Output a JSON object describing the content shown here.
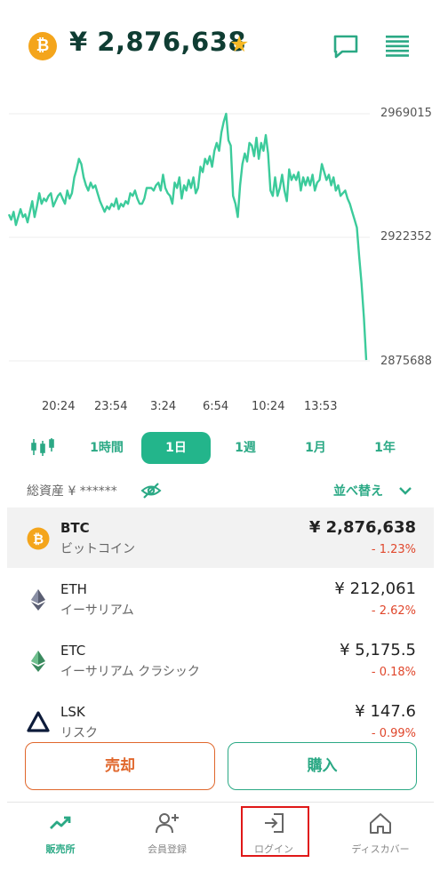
{
  "header": {
    "coin_symbol_glyph": "₿",
    "price": "¥ 2,876,638",
    "star_icon": "star-icon",
    "chat_icon": "chat-icon",
    "menu_icon": "menu-icon"
  },
  "chart_data": {
    "type": "line",
    "y_ticks": [
      "2969015",
      "2922352",
      "2875688"
    ],
    "ylim": [
      2875688,
      2969015
    ],
    "x_ticks": [
      "20:24",
      "23:54",
      "3:24",
      "6:54",
      "10:24",
      "13:53"
    ],
    "series": [
      {
        "values": [
          2931000,
          2929000,
          2932000,
          2927000,
          2930000,
          2933000,
          2930000,
          2931000,
          2928000,
          2932000,
          2936000,
          2930000,
          2934000,
          2939000,
          2935000,
          2937000,
          2936000,
          2938000,
          2939000,
          2934000,
          2936000,
          2938000,
          2939000,
          2937000,
          2935000,
          2940000,
          2937000,
          2939000,
          2945000,
          2948000,
          2952000,
          2950000,
          2945000,
          2942000,
          2940000,
          2943000,
          2941000,
          2942000,
          2939000,
          2936000,
          2934000,
          2932000,
          2934000,
          2933000,
          2935000,
          2934000,
          2937000,
          2933000,
          2935000,
          2934000,
          2936000,
          2935000,
          2939000,
          2938000,
          2940000,
          2937000,
          2935000,
          2935000,
          2937000,
          2941000,
          2941000,
          2941000,
          2940000,
          2942000,
          2943000,
          2940000,
          2946000,
          2941000,
          2939000,
          2938000,
          2935000,
          2943000,
          2941000,
          2945000,
          2937000,
          2942000,
          2940000,
          2944000,
          2941000,
          2945000,
          2939000,
          2941000,
          2949000,
          2947000,
          2952000,
          2950000,
          2953000,
          2949000,
          2955000,
          2958000,
          2955000,
          2962000,
          2966000,
          2969000,
          2959000,
          2957000,
          2938000,
          2935000,
          2930000,
          2942000,
          2950000,
          2954000,
          2951000,
          2958000,
          2957000,
          2953000,
          2960000,
          2952000,
          2958000,
          2955000,
          2961000,
          2954000,
          2940000,
          2938000,
          2945000,
          2938000,
          2941000,
          2946000,
          2940000,
          2936000,
          2948000,
          2944000,
          2946000,
          2944000,
          2947000,
          2940000,
          2945000,
          2942000,
          2945000,
          2942000,
          2946000,
          2940000,
          2943000,
          2944000,
          2950000,
          2947000,
          2944000,
          2946000,
          2942000,
          2945000,
          2940000,
          2942000,
          2938000,
          2939000,
          2940000,
          2937000,
          2935000,
          2932000,
          2929000,
          2926000,
          2915000,
          2905000,
          2892000,
          2876000
        ],
        "color": "#3CCB9B"
      }
    ]
  },
  "periods": {
    "candle_icon": "candlestick-icon",
    "items": [
      "1時間",
      "1日",
      "1週",
      "1月",
      "1年"
    ],
    "active": "1日"
  },
  "assets": {
    "label": "総資産 ¥ ******",
    "eye_icon": "eye-off-icon",
    "sort_label": "並べ替え"
  },
  "coins": [
    {
      "symbol": "BTC",
      "name": "ビットコイン",
      "price": "¥ 2,876,638",
      "change": "- 1.23%",
      "icon": "bitcoin-icon"
    },
    {
      "symbol": "ETH",
      "name": "イーサリアム",
      "price": "¥ 212,061",
      "change": "- 2.62%",
      "icon": "ethereum-icon"
    },
    {
      "symbol": "ETC",
      "name": "イーサリアム クラシック",
      "price": "¥ 5,175.5",
      "change": "- 0.18%",
      "icon": "ethereum-classic-icon"
    },
    {
      "symbol": "LSK",
      "name": "リスク",
      "price": "¥ 147.6",
      "change": "- 0.99%",
      "icon": "lisk-icon"
    }
  ],
  "actions": {
    "sell": "売却",
    "buy": "購入"
  },
  "nav": [
    {
      "label": "販売所",
      "icon": "trend-up-icon",
      "active": true
    },
    {
      "label": "会員登録",
      "icon": "add-user-icon",
      "active": false
    },
    {
      "label": "ログイン",
      "icon": "login-icon",
      "active": false
    },
    {
      "label": "ディスカバー",
      "icon": "home-icon",
      "active": false
    }
  ],
  "colors": {
    "accent": "#2BA985",
    "line": "#3CCB9B",
    "sell": "#E0672C",
    "negative": "#E0472C",
    "bitcoin": "#F4A51C"
  }
}
